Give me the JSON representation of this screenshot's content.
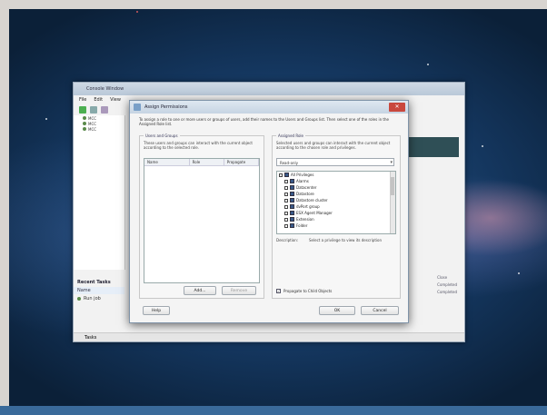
{
  "app": {
    "title": "Console Window",
    "menu": [
      "File",
      "Edit",
      "View"
    ],
    "tree_items": [
      "MCC",
      "MCC",
      "MCC"
    ],
    "recent_title": "Recent Tasks",
    "recent_column": "Name",
    "recent_row": "Run job",
    "status": "Tasks",
    "right_labels": [
      "Close",
      "Completed",
      "Completed"
    ]
  },
  "dialog": {
    "title": "Assign Permissions",
    "close_glyph": "✕",
    "intro": "To assign a role to one or more users or groups of users, add their names to the Users and Groups list. Then select one of the roles in the Assigned Role list.",
    "users_group": {
      "label": "Users and Groups",
      "description": "These users and groups can interact with the current object according to the selected role.",
      "columns": [
        "Name",
        "Role",
        "Propagate"
      ],
      "add_label": "Add...",
      "remove_label": "Remove"
    },
    "role_group": {
      "label": "Assigned Role",
      "description": "Selected users and groups can interact with the current object according to the chosen role and privileges.",
      "role_value": "Read-only",
      "tree": [
        "All Privileges",
        "Alarms",
        "Datacenter",
        "Datastore",
        "Datastore cluster",
        "dvPort group",
        "ESX Agent Manager",
        "Extension",
        "Folder"
      ],
      "description_label": "Description:",
      "description_text": "Select a privilege to view its description",
      "propagate_label": "Propagate to Child Objects"
    },
    "help_label": "Help",
    "ok_label": "OK",
    "cancel_label": "Cancel"
  },
  "colors": {
    "accent": "#2f4f56",
    "close_red": "#c9483e",
    "title_bar": "#c6d4e3"
  },
  "icons": [
    "window-icon",
    "close-icon",
    "checkbox-icon",
    "expand-icon"
  ]
}
